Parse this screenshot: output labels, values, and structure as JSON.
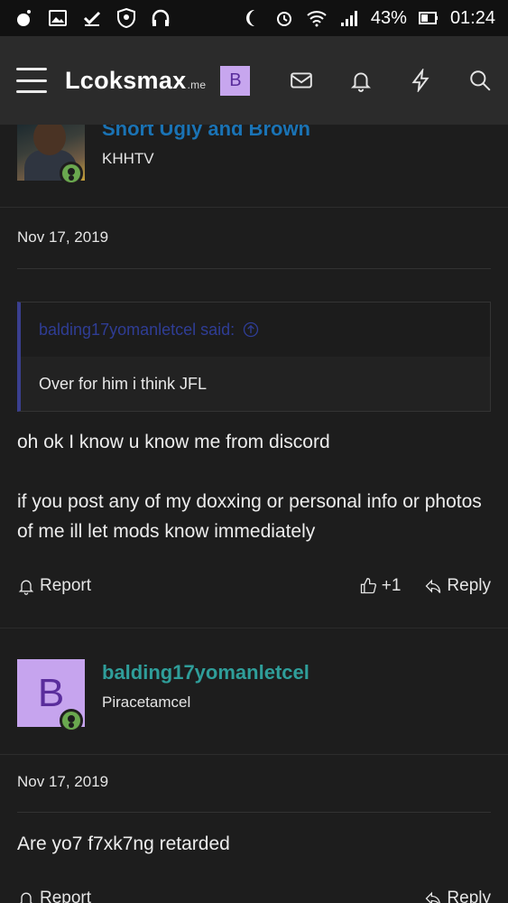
{
  "status_bar": {
    "battery": "43%",
    "time": "01:24"
  },
  "nav": {
    "logo_main": "Lcoksmax",
    "logo_suffix": ".me",
    "user_initial": "B"
  },
  "post1": {
    "username": "Short Ugly and Brown",
    "user_title": "KHHTV",
    "date": "Nov 17, 2019",
    "quote_author": "balding17yomanletcel said:",
    "quote_text": "Over for him i think JFL",
    "message_line1": "oh ok I know u know me from discord",
    "message_line2": "if you post any of my doxxing or personal info or photos of me ill let mods know immediately",
    "report_label": "Report",
    "like_count": "+1",
    "reply_label": "Reply"
  },
  "post2": {
    "avatar_initial": "B",
    "username": "balding17yomanletcel",
    "user_title": "Piracetamcel",
    "date": "Nov 17, 2019",
    "message": "Are yo7 f7xk7ng retarded",
    "report_label": "Report",
    "reply_label": "Reply"
  },
  "colors": {
    "username_teal": "#2f9e9a",
    "username_blue": "#1a73b5",
    "quote_accent": "#2f3d95",
    "avatar_bg": "#c6a4ee",
    "online_green": "#6aa84f"
  }
}
